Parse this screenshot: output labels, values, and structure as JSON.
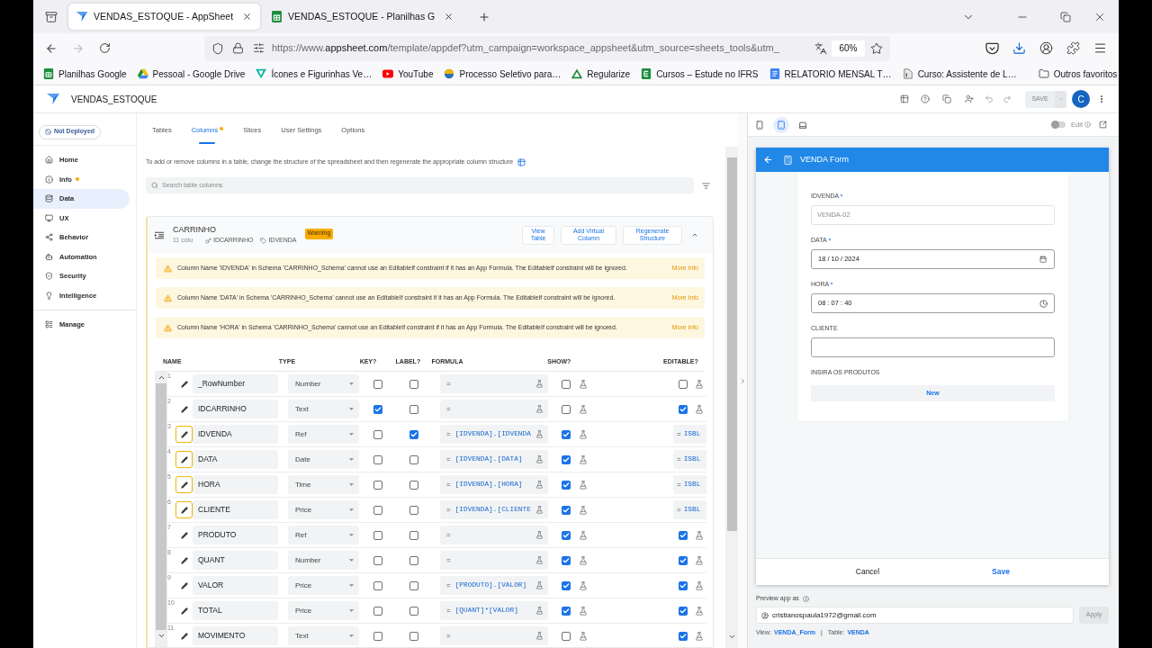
{
  "browser": {
    "tabs": [
      {
        "title": "VENDAS_ESTOQUE - AppSheet",
        "selected": true
      },
      {
        "title": "VENDAS_ESTOQUE - Planilhas G",
        "selected": false
      }
    ],
    "url": {
      "scheme": "https://www.",
      "host": "appsheet.com",
      "path": "/template/appdef?utm_campaign=workspace_appsheet&utm_source=sheets_tools&utm_"
    },
    "zoom": "60%",
    "bookmarks": [
      "Planilhas Google",
      "Pessoal - Google Drive",
      "Ícones e Figurinhas Ve…",
      "YouTube",
      "Processo Seletivo para…",
      "Regularize",
      "Cursos – Estude no IFRS",
      "RELATORIO MENSAL T…",
      "Curso: Assistente de L…"
    ],
    "other_bookmarks": "Outros favoritos"
  },
  "app": {
    "title": "VENDAS_ESTOQUE",
    "save": "SAVE",
    "avatar": "C"
  },
  "sidebar": {
    "status": "Not Deployed",
    "items": [
      {
        "label": "Home",
        "selected": false,
        "dot": false
      },
      {
        "label": "Info",
        "selected": false,
        "dot": true
      },
      {
        "label": "Data",
        "selected": true,
        "dot": false
      },
      {
        "label": "UX",
        "selected": false,
        "dot": false
      },
      {
        "label": "Behavior",
        "selected": false,
        "dot": false
      },
      {
        "label": "Automation",
        "selected": false,
        "dot": false
      },
      {
        "label": "Security",
        "selected": false,
        "dot": false
      },
      {
        "label": "Intelligence",
        "selected": false,
        "dot": false
      }
    ],
    "manage": {
      "label": "Manage",
      "selected": false
    }
  },
  "data_tabs": [
    {
      "label": "Tables",
      "selected": false,
      "dot": false
    },
    {
      "label": "Columns",
      "selected": true,
      "dot": true
    },
    {
      "label": "Slices",
      "selected": false,
      "dot": false
    },
    {
      "label": "User Settings",
      "selected": false,
      "dot": false
    },
    {
      "label": "Options",
      "selected": false,
      "dot": false
    }
  ],
  "hint": "To add or remove columns in a table, change the structure of the spreadsheet and then regenerate the appropriate column structure",
  "search": {
    "placeholder": "Search table columns"
  },
  "table": {
    "name": "CARRINHO",
    "count": "11 colu",
    "key": "IDCARRINHO",
    "label": "IDVENDA",
    "badge": "Warning",
    "expanded": true,
    "actions": [
      "View Table",
      "Add Virtual Column",
      "Regenerate Structure"
    ],
    "warnings": [
      {
        "text": "Column Name 'IDVENDA' in Schema 'CARRINHO_Schema' cannot use an EditableIf constraint if it has an App Formula. The EditableIf constraint will be ignored.",
        "link": "More info"
      },
      {
        "text": "Column Name 'DATA' in Schema 'CARRINHO_Schema' cannot use an EditableIf constraint if it has an App Formula. The EditableIf constraint will be ignored.",
        "link": "More info"
      },
      {
        "text": "Column Name 'HORA' in Schema 'CARRINHO_Schema' cannot use an EditableIf constraint if it has an App Formula. The EditableIf constraint will be ignored.",
        "link": "More info"
      }
    ],
    "columns": [
      "NAME",
      "TYPE",
      "KEY?",
      "LABEL?",
      "FORMULA",
      "SHOW?",
      "EDITABLE?"
    ],
    "rows": [
      {
        "num": "1",
        "name": "_RowNumber",
        "type": "Number",
        "warning": false,
        "key": false,
        "label": false,
        "formula": {
          "sign": "="
        },
        "show": false,
        "editable": {
          "kind": "check",
          "checked": false
        }
      },
      {
        "num": "2",
        "name": "IDCARRINHO",
        "type": "Text",
        "warning": false,
        "key": true,
        "label": false,
        "formula": {
          "sign": "="
        },
        "show": false,
        "editable": {
          "kind": "check",
          "checked": true
        }
      },
      {
        "num": "3",
        "name": "IDVENDA",
        "type": "Ref",
        "warning": true,
        "key": false,
        "label": true,
        "formula": {
          "sign": "=",
          "expr": "[IDVENDA].[IDVENDA"
        },
        "show": true,
        "editable": {
          "kind": "formula",
          "sign": "=",
          "expr": "ISBL"
        }
      },
      {
        "num": "4",
        "name": "DATA",
        "type": "Date",
        "warning": true,
        "key": false,
        "label": false,
        "formula": {
          "sign": "=",
          "expr": "[IDVENDA].[DATA]"
        },
        "show": true,
        "editable": {
          "kind": "formula",
          "sign": "=",
          "expr": "ISBL"
        }
      },
      {
        "num": "5",
        "name": "HORA",
        "type": "Time",
        "warning": true,
        "key": false,
        "label": false,
        "formula": {
          "sign": "=",
          "expr": "[IDVENDA].[HORA]"
        },
        "show": true,
        "editable": {
          "kind": "formula",
          "sign": "=",
          "expr": "ISBL"
        }
      },
      {
        "num": "6",
        "name": "CLIENTE",
        "type": "Price",
        "warning": true,
        "key": false,
        "label": false,
        "formula": {
          "sign": "=",
          "expr": "[IDVENDA].[CLIENTE"
        },
        "show": true,
        "editable": {
          "kind": "formula",
          "sign": "=",
          "expr": "ISBL"
        }
      },
      {
        "num": "7",
        "name": "PRODUTO",
        "type": "Ref",
        "warning": false,
        "key": false,
        "label": false,
        "formula": {
          "sign": "="
        },
        "show": true,
        "editable": {
          "kind": "check",
          "checked": true
        }
      },
      {
        "num": "8",
        "name": "QUANT",
        "type": "Number",
        "warning": false,
        "key": false,
        "label": false,
        "formula": {
          "sign": "="
        },
        "show": true,
        "editable": {
          "kind": "check",
          "checked": true
        }
      },
      {
        "num": "9",
        "name": "VALOR",
        "type": "Price",
        "warning": false,
        "key": false,
        "label": false,
        "formula": {
          "sign": "=",
          "expr": "[PRODUTO].[VALOR]"
        },
        "show": true,
        "editable": {
          "kind": "check",
          "checked": true
        }
      },
      {
        "num": "10",
        "name": "TOTAL",
        "type": "Price",
        "warning": false,
        "key": false,
        "label": false,
        "formula": {
          "sign": "=",
          "expr": "[QUANT]*[VALOR]"
        },
        "show": true,
        "editable": {
          "kind": "check",
          "checked": true
        }
      },
      {
        "num": "11",
        "name": "MOVIMENTO",
        "type": "Text",
        "warning": false,
        "key": false,
        "label": false,
        "formula": {
          "sign": "="
        },
        "show": false,
        "editable": {
          "kind": "check",
          "checked": true
        }
      }
    ]
  },
  "preview": {
    "devices": [
      {
        "selected": false
      },
      {
        "selected": true
      },
      {
        "selected": false
      }
    ],
    "edit": {
      "label": "Edit",
      "on": false
    },
    "form": {
      "title": "VENDA Form",
      "fields": [
        {
          "label": "IDVENDA",
          "required": true,
          "kind": "readonly",
          "value": "VENDA-02"
        },
        {
          "label": "DATA",
          "required": true,
          "kind": "date",
          "value": "18 / 10 / 2024"
        },
        {
          "label": "HORA",
          "required": true,
          "kind": "time",
          "value": "08 : 07 : 40"
        },
        {
          "label": "CLIENTE",
          "required": false,
          "kind": "text"
        },
        {
          "label": "INSIRA OS PRODUTOS",
          "required": false,
          "kind": "list",
          "button": "New"
        }
      ],
      "cancel": "Cancel",
      "save": "Save"
    },
    "preview_as": {
      "label": "Preview app as",
      "email": "cristianospaula1972@gmail.com",
      "apply": "Apply"
    },
    "info": {
      "view_label": "View:",
      "view": "VENDA_Form",
      "separator": "|",
      "table_label": "Table:",
      "table": "VENDA"
    }
  }
}
